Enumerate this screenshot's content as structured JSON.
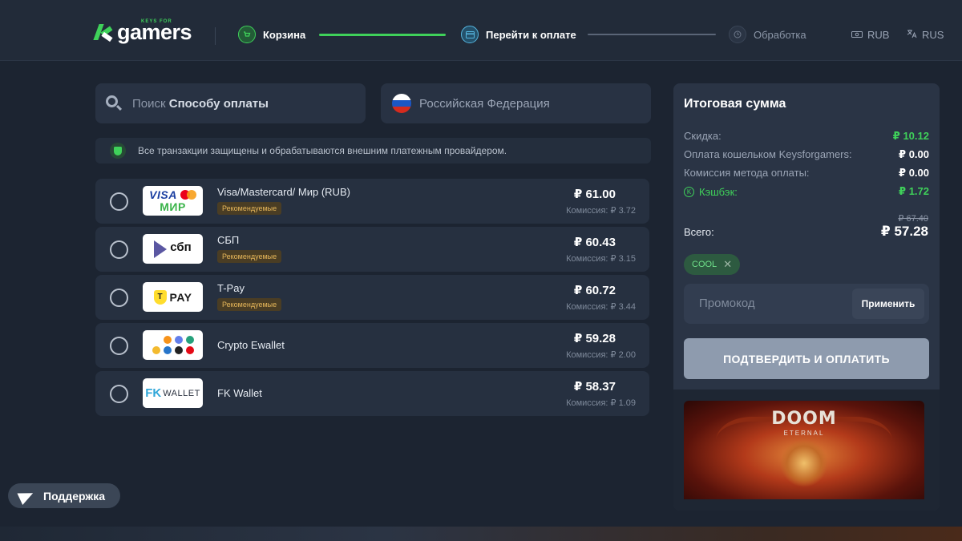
{
  "header": {
    "logo_small": "KEYS FOR",
    "logo_big": "gamers",
    "steps": [
      {
        "label": "Корзина",
        "state": "done"
      },
      {
        "label": "Перейти к оплате",
        "state": "active"
      },
      {
        "label": "Обработка",
        "state": "pending"
      }
    ],
    "currency": "RUB",
    "language": "RUS"
  },
  "search": {
    "prefix": "Поиск",
    "bold": "Способу оплаты"
  },
  "country": {
    "label": "Российская Федерация"
  },
  "secure_note": "Все транзакции защищены и обрабатываются внешним платежным провайдером.",
  "payment_methods": [
    {
      "name": "Visa/Mastercard/ Мир (RUB)",
      "badge": "Рекомендуемые",
      "price": "₽ 61.00",
      "fee": "Комиссия: ₽ 3.72",
      "logo": "visa-mc-mir"
    },
    {
      "name": "СБП",
      "badge": "Рекомендуемые",
      "price": "₽ 60.43",
      "fee": "Комиссия: ₽ 3.15",
      "logo": "sbp",
      "logo_text": "сбп"
    },
    {
      "name": "T-Pay",
      "badge": "Рекомендуемые",
      "price": "₽ 60.72",
      "fee": "Комиссия: ₽ 3.44",
      "logo": "tpay",
      "logo_text": "PAY"
    },
    {
      "name": "Crypto Ewallet",
      "badge": "",
      "price": "₽ 59.28",
      "fee": "Комиссия: ₽ 2.00",
      "logo": "crypto"
    },
    {
      "name": "FK Wallet",
      "badge": "",
      "price": "₽ 58.37",
      "fee": "Комиссия: ₽ 1.09",
      "logo": "fk-wallet",
      "logo_text": "WALLET"
    }
  ],
  "logo_labels": {
    "visa": "VISA",
    "mir": "МИР"
  },
  "summary": {
    "title": "Итоговая сумма",
    "discount_label": "Скидка:",
    "discount_value": "₽ 10.12",
    "wallet_label": "Оплата кошельком Keysforgamers:",
    "wallet_value": "₽ 0.00",
    "fee_label": "Комиссия метода оплаты:",
    "fee_value": "₽ 0.00",
    "cashback_label": "Кэшбэк:",
    "cashback_value": "₽ 1.72",
    "old_total": "₽ 67.40",
    "total_label": "Всего:",
    "total_value": "₽ 57.28",
    "coupon_code": "COOL",
    "promo_placeholder": "Промокод",
    "apply_label": "Применить",
    "confirm_label": "ПОДТВЕРДИТЬ И ОПЛАТИТЬ"
  },
  "game": {
    "title": "DOOM",
    "subtitle": "ETERNAL"
  },
  "support_label": "Поддержка",
  "colors": {
    "accent_green": "#3fd15a",
    "background": "#1c2431",
    "panel": "#2a3445",
    "badge": "#e8b85a"
  }
}
